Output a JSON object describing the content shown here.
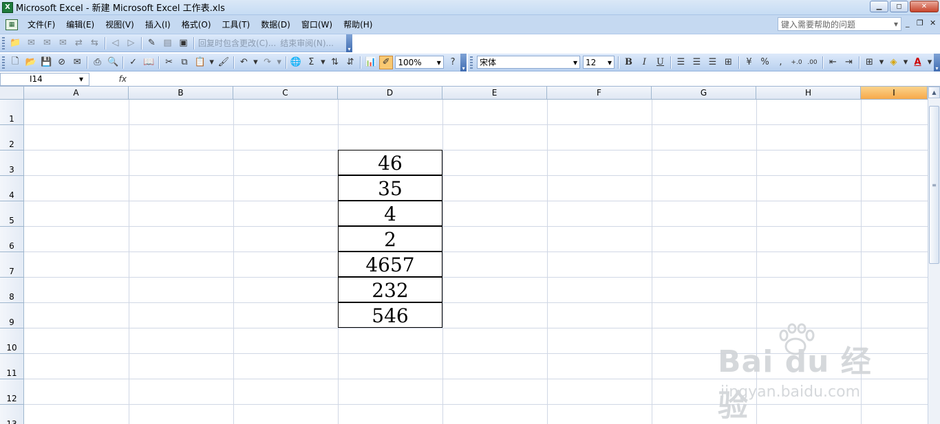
{
  "window": {
    "title": "Microsoft Excel - 新建 Microsoft Excel 工作表.xls",
    "app_icon_text": "X",
    "minimize_glyph": "▁",
    "maximize_glyph": "◻",
    "close_glyph": "✕"
  },
  "menubar": {
    "items": [
      "文件(F)",
      "编辑(E)",
      "视图(V)",
      "插入(I)",
      "格式(O)",
      "工具(T)",
      "数据(D)",
      "窗口(W)",
      "帮助(H)"
    ],
    "help_placeholder": "键入需要帮助的问题",
    "help_dropdown_glyph": "▾",
    "doc_ctrls": [
      "_",
      "❐",
      "✕"
    ]
  },
  "review_toolbar": {
    "reply_with_changes": "回复时包含更改(C)...",
    "end_review": "结束审阅(N)..."
  },
  "standard_toolbar": {
    "zoom": "100%",
    "sum_glyph": "Σ"
  },
  "format_toolbar": {
    "font_name": "宋体",
    "font_size": "12",
    "bold": "B",
    "italic": "I",
    "underline": "U",
    "percent": "%",
    "comma": ",",
    "font_color_glyph": "A"
  },
  "formula_bar": {
    "name_box": "I14",
    "fx_label": "fx",
    "dropdown_glyph": "▾"
  },
  "sheet": {
    "columns": [
      "A",
      "B",
      "C",
      "D",
      "E",
      "F",
      "G",
      "H",
      "I"
    ],
    "selected_column": "I",
    "rows": [
      "1",
      "2",
      "3",
      "4",
      "5",
      "6",
      "7",
      "8",
      "9",
      "10",
      "11",
      "12",
      "13"
    ],
    "d_values": [
      "46",
      "35",
      "4",
      "2",
      "4657",
      "232",
      "546"
    ]
  },
  "watermark": {
    "main": "Bai du 经验",
    "sub": "jingyan.baidu.com"
  }
}
